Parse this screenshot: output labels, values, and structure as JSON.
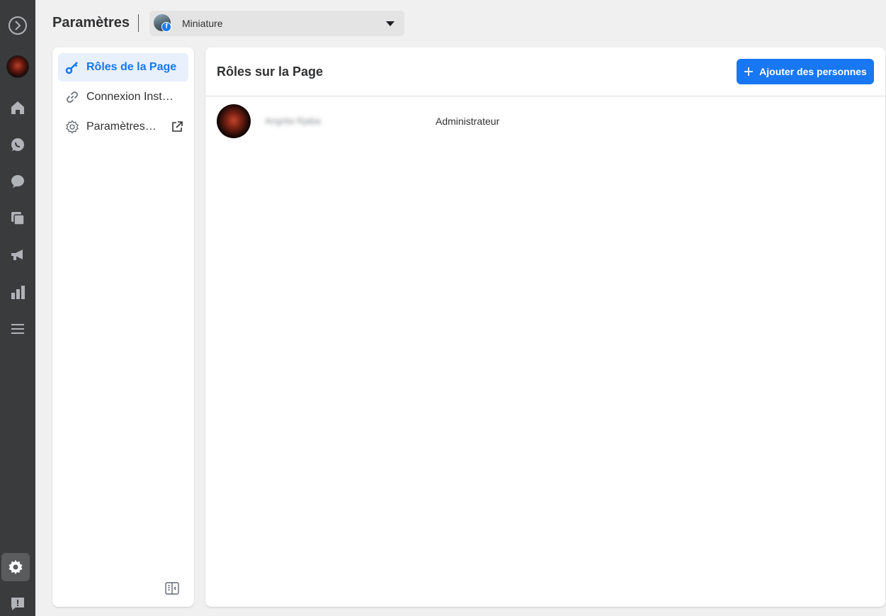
{
  "header": {
    "title": "Paramètres",
    "page_selector": {
      "selected": "Miniature"
    }
  },
  "rail": {
    "items": [
      {
        "name": "meta-logo-icon"
      },
      {
        "name": "page-avatar"
      },
      {
        "name": "home-icon"
      },
      {
        "name": "whatsapp-icon"
      },
      {
        "name": "messenger-icon"
      },
      {
        "name": "content-icon"
      },
      {
        "name": "ads-megaphone-icon"
      },
      {
        "name": "insights-bars-icon"
      },
      {
        "name": "menu-icon"
      },
      {
        "name": "settings-gear-icon",
        "active": true
      },
      {
        "name": "report-problem-icon"
      }
    ]
  },
  "sidebar": {
    "items": [
      {
        "label": "Rôles de la Page",
        "icon": "key-icon",
        "active": true
      },
      {
        "label": "Connexion Instagram",
        "icon": "link-icon"
      },
      {
        "label": "Paramètres de la Page",
        "icon": "gear-outline-icon",
        "external": true
      }
    ]
  },
  "main": {
    "title": "Rôles sur la Page",
    "add_button_label": "Ajouter des personnes",
    "roles": [
      {
        "name": "Angrita Rjaba",
        "role": "Administrateur"
      }
    ]
  },
  "colors": {
    "accent": "#1877f2",
    "rail_bg": "#3a3b3c",
    "page_bg": "#f0f0f0",
    "active_nav_bg": "#e7f0fb"
  }
}
